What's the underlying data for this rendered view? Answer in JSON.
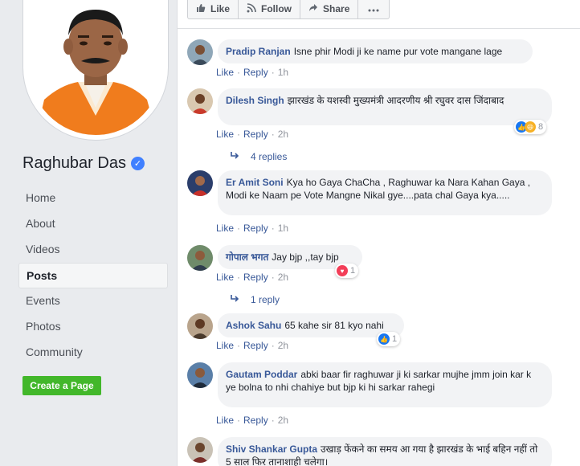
{
  "page": {
    "name": "Raghubar Das"
  },
  "sidebar": {
    "items": [
      {
        "label": "Home",
        "active": false
      },
      {
        "label": "About",
        "active": false
      },
      {
        "label": "Videos",
        "active": false
      },
      {
        "label": "Posts",
        "active": true
      },
      {
        "label": "Events",
        "active": false
      },
      {
        "label": "Photos",
        "active": false
      },
      {
        "label": "Community",
        "active": false
      }
    ],
    "create_page": "Create a Page"
  },
  "post_actions": {
    "like": "Like",
    "follow": "Follow",
    "share": "Share"
  },
  "comment_actions": {
    "like": "Like",
    "reply": "Reply"
  },
  "comments": [
    {
      "name": "Pradip Ranjan",
      "text": "Isne phir Modi ji ke name pur vote mangane lage",
      "time": "1h"
    },
    {
      "name": "Dilesh Singh",
      "text": "झारखंड के यशस्वी मुख्यमंत्री आदरणीय श्री रघुवर दास जिंदाबाद",
      "time": "2h",
      "reaction_count": "8",
      "replies": "4 replies"
    },
    {
      "name": "Er Amit Soni",
      "text": "Kya ho Gaya ChaCha , Raghuwar ka Nara Kahan Gaya , Modi ke Naam pe Vote Mangne Nikal gye....pata chal Gaya kya.....",
      "time": "1h"
    },
    {
      "name": "गोपाल भगत",
      "text": "Jay bjp ,,tay bjp",
      "time": "2h",
      "reaction_count": "1",
      "replies": "1 reply"
    },
    {
      "name": "Ashok Sahu",
      "text": "65 kahe sir 81 kyo nahi",
      "time": "2h",
      "reaction_count": "1"
    },
    {
      "name": "Gautam Poddar",
      "text": "abki baar fir raghuwar ji ki sarkar mujhe jmm join kar k ye bolna to nhi chahiye but bjp ki hi sarkar rahegi",
      "time": "2h"
    },
    {
      "name": "Shiv Shankar Gupta",
      "text": "उखाड़ फेंकने का समय आ गया है झारखंड के भाई बहिन नहीं तो 5 साल फिर तानाशाही चलेगा।",
      "time": ""
    }
  ],
  "colors": {
    "link": "#385898",
    "create_button": "#42b72a",
    "verified": "#4080ff",
    "like_reaction": "#1877f2",
    "love_reaction": "#f33e58",
    "haha_reaction": "#f7b125"
  }
}
